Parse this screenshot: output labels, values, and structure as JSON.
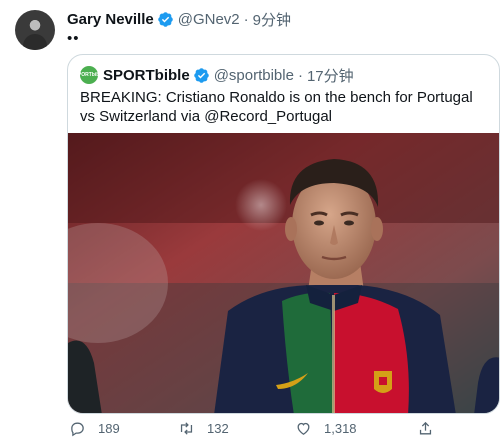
{
  "tweet": {
    "author_name": "Gary Neville",
    "handle": "@GNev2",
    "separator": "·",
    "time": "9分钟",
    "text": "••"
  },
  "quoted": {
    "avatar_text": "SPORTbible",
    "author_name": "SPORTbible",
    "handle": "@sportbible",
    "separator": "·",
    "time": "17分钟",
    "text": "BREAKING: Cristiano Ronaldo is on the bench for Portugal vs Switzerland via @Record_Portugal"
  },
  "actions": {
    "reply_count": "189",
    "retweet_count": "132",
    "like_count": "1,318"
  },
  "icons": [
    "verified-badge-icon",
    "reply-icon",
    "retweet-icon",
    "like-icon",
    "share-icon"
  ],
  "colors": {
    "verified_blue": "#1d9bf0",
    "secondary_text": "#536471",
    "border": "#cfd9de",
    "jersey_red": "#c8102e",
    "jersey_green": "#1f6b3a",
    "jersey_navy": "#1a2342",
    "nike_gold": "#d4a017"
  }
}
